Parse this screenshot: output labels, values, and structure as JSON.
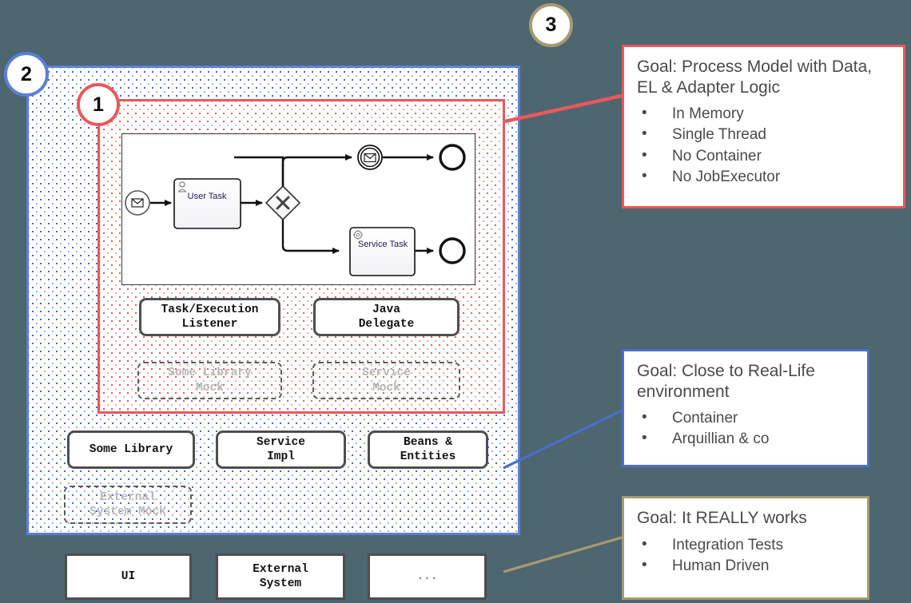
{
  "background_color": "#4d6670",
  "badges": [
    {
      "id": "1",
      "label": "1",
      "color": "#e8595a"
    },
    {
      "id": "2",
      "label": "2",
      "color": "#5b7fd4"
    },
    {
      "id": "3",
      "label": "3",
      "color": "#a79a71"
    }
  ],
  "process": {
    "start_event": "message-start-event",
    "user_task": "User Task",
    "gateway": "exclusive-gateway",
    "intermediate_event": "intermediate-message-event",
    "service_task": "Service Task",
    "end_event_top": "end-event",
    "end_event_bottom": "end-event"
  },
  "red_layer": {
    "boxes": [
      {
        "label": "Task/Execution\nListener",
        "style": "solid"
      },
      {
        "label": "Java\nDelegate",
        "style": "solid"
      }
    ],
    "mocks": [
      {
        "label": "Some Library\nMock",
        "style": "dashed"
      },
      {
        "label": "Service\nMock",
        "style": "dashed"
      }
    ]
  },
  "blue_layer": {
    "boxes": [
      {
        "label": "Some Library",
        "style": "solid"
      },
      {
        "label": "Service\nImpl",
        "style": "solid"
      },
      {
        "label": "Beans &\nEntities",
        "style": "solid"
      }
    ],
    "mocks": [
      {
        "label": "External\nSystem Mock",
        "style": "dashed"
      }
    ]
  },
  "outside_layer": {
    "boxes": [
      {
        "label": "UI"
      },
      {
        "label": "External\nSystem"
      },
      {
        "label": "..."
      }
    ]
  },
  "callouts": [
    {
      "id": "callout-1",
      "border_color": "#e8595a",
      "title": "Goal: Process Model with Data, EL & Adapter Logic",
      "items": [
        "In Memory",
        "Single Thread",
        "No Container",
        "No JobExecutor"
      ]
    },
    {
      "id": "callout-2",
      "border_color": "#4a6fc9",
      "title": "Goal: Close to Real-Life environment",
      "items": [
        "Container",
        "Arquillian & co"
      ]
    },
    {
      "id": "callout-3",
      "border_color": "#a79a71",
      "title": "Goal: It REALLY works",
      "items": [
        "Integration Tests",
        "Human Driven"
      ]
    }
  ]
}
